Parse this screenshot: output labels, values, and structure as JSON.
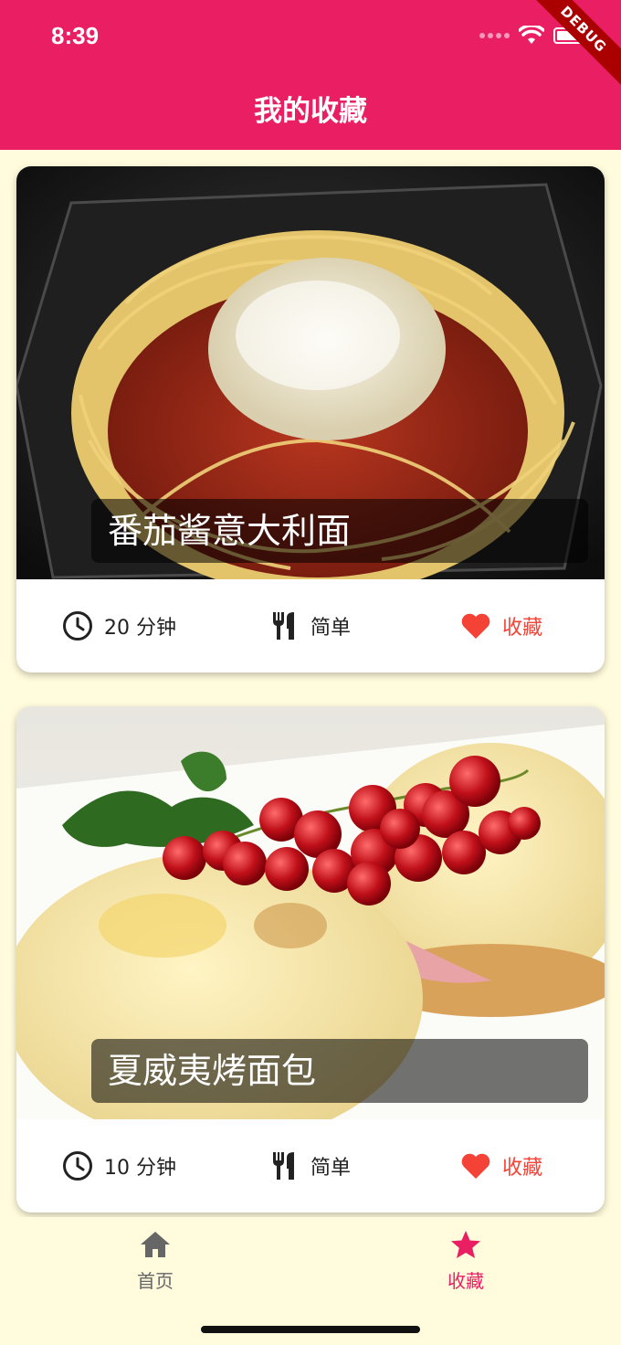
{
  "status_bar": {
    "time": "8:39",
    "debug_label": "DEBUG"
  },
  "app_bar": {
    "title": "我的收藏"
  },
  "colors": {
    "primary": "#e91e63",
    "favorite": "#f44336",
    "background": "#fffbdc"
  },
  "meals": [
    {
      "title": "番茄酱意大利面",
      "duration": "20 分钟",
      "complexity": "简单",
      "favorite_label": "收藏"
    },
    {
      "title": "夏威夷烤面包",
      "duration": "10 分钟",
      "complexity": "简单",
      "favorite_label": "收藏"
    }
  ],
  "bottom_nav": {
    "items": [
      {
        "label": "首页",
        "icon": "home-icon",
        "active": false
      },
      {
        "label": "收藏",
        "icon": "star-icon",
        "active": true
      }
    ]
  }
}
